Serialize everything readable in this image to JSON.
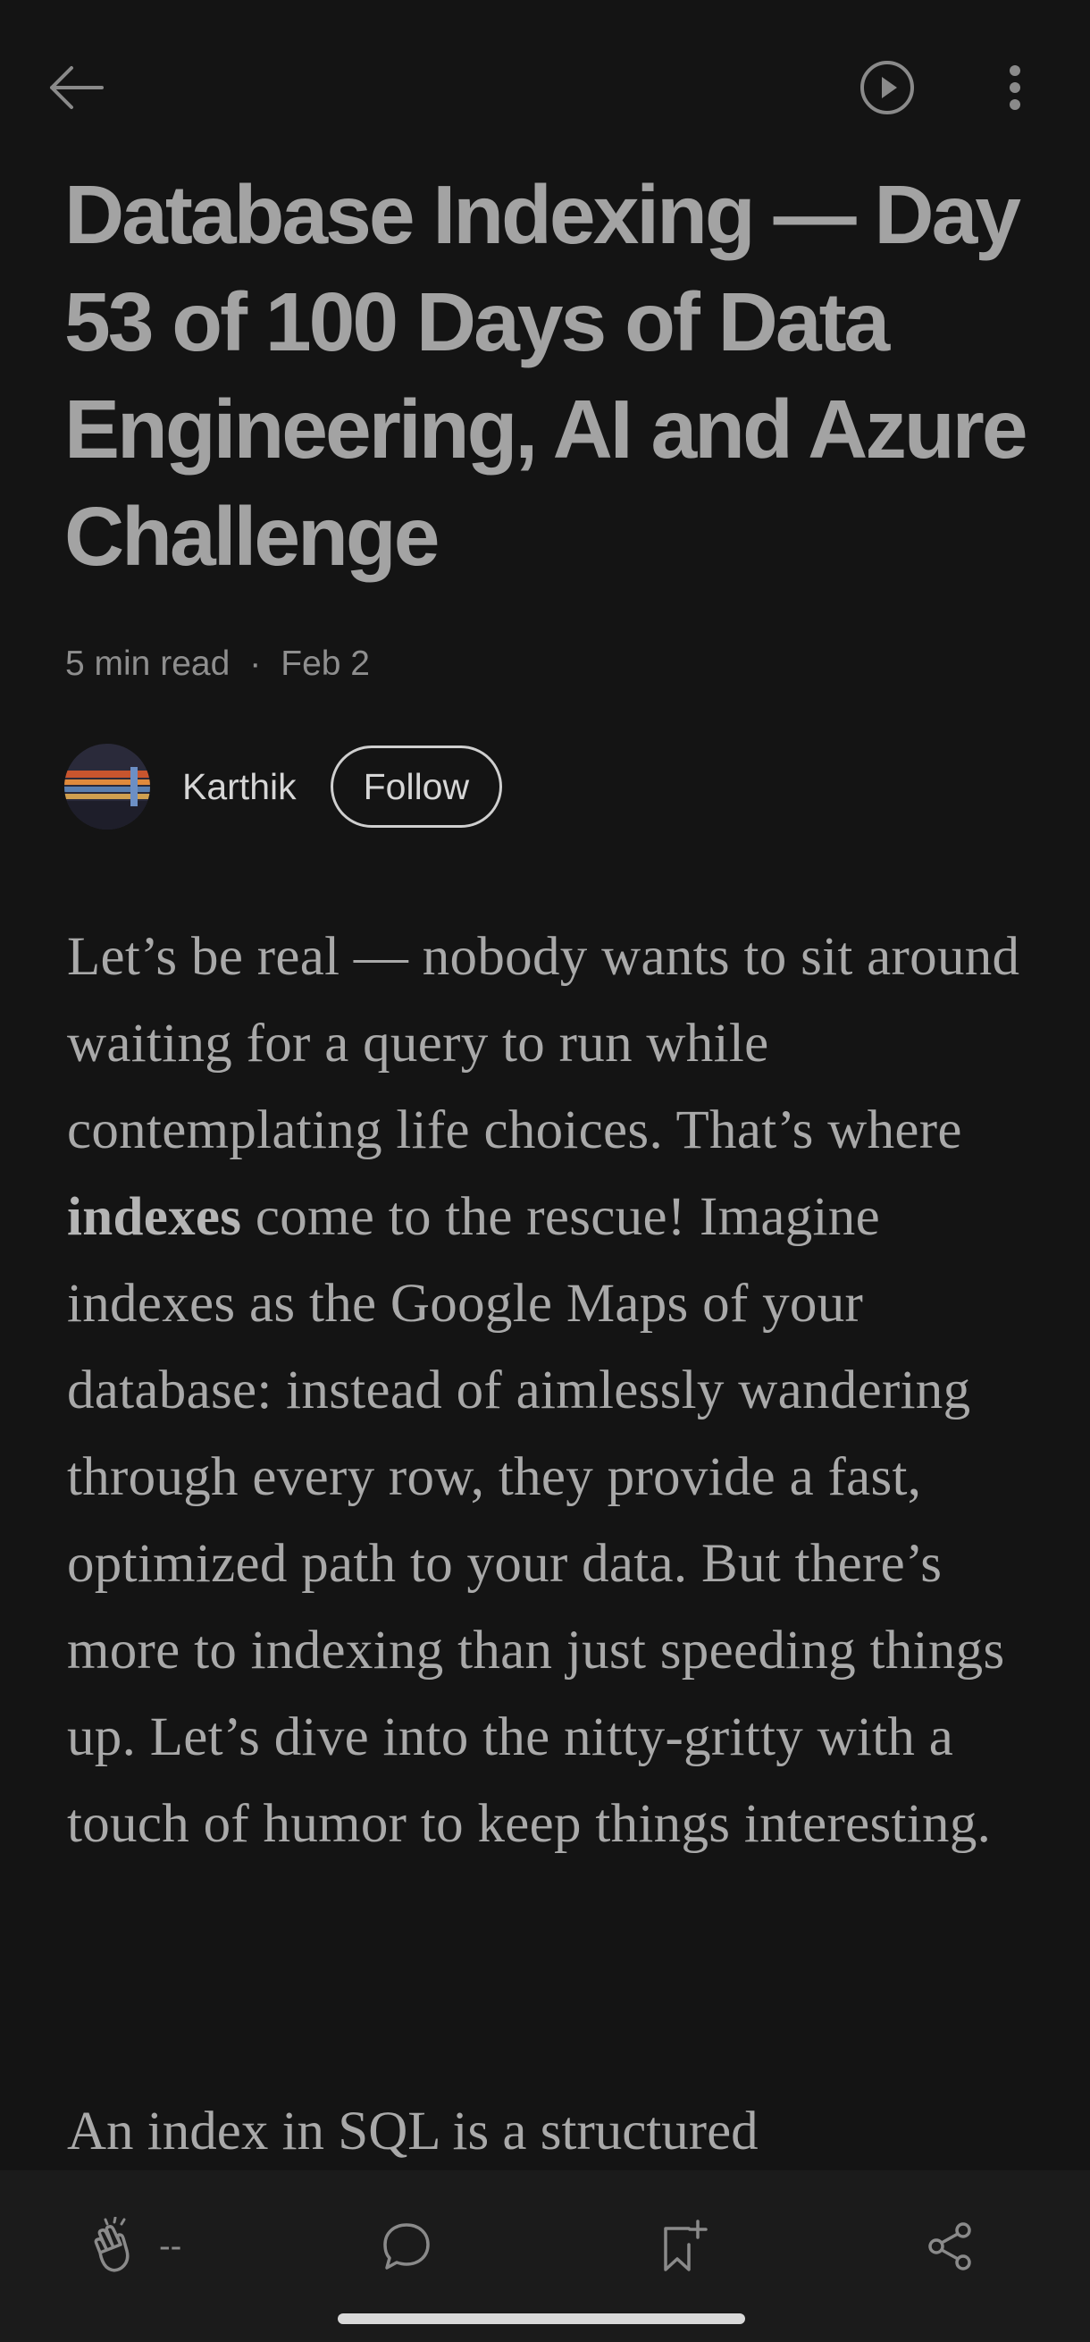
{
  "article": {
    "title": "Database Indexing — Day 53 of 100 Days of Data Engineering, AI and Azure Challenge",
    "read_time": "5 min read",
    "separator": "·",
    "date": "Feb 2"
  },
  "author": {
    "name": "Karthik",
    "follow_label": "Follow"
  },
  "body": {
    "p1_part1": "Let’s be real — nobody wants to sit around waiting for a query to run while contemplating life choices. That’s where ",
    "p1_bold": "indexes",
    "p1_part2": " come to the rescue! Imagine indexes as the Google Maps of your database: instead of aimlessly wandering through every row, they provide a fast, optimized path to your data. But there’s more to indexing than just speeding things up. Let’s dive into the nitty-gritty with a touch of humor to keep things interesting.",
    "p2_start": "An index in SQL is a structured"
  },
  "toolbar": {
    "clap_count": "--"
  },
  "icons": {
    "back": "arrow-left-icon",
    "listen": "play-circle-icon",
    "more": "more-vertical-icon",
    "clap": "clap-icon",
    "comment": "comment-icon",
    "save": "bookmark-add-icon",
    "share": "share-icon"
  },
  "colors": {
    "background": "#141414",
    "bottom_bar": "#1b1b1b",
    "text": "#a9a9a9"
  }
}
